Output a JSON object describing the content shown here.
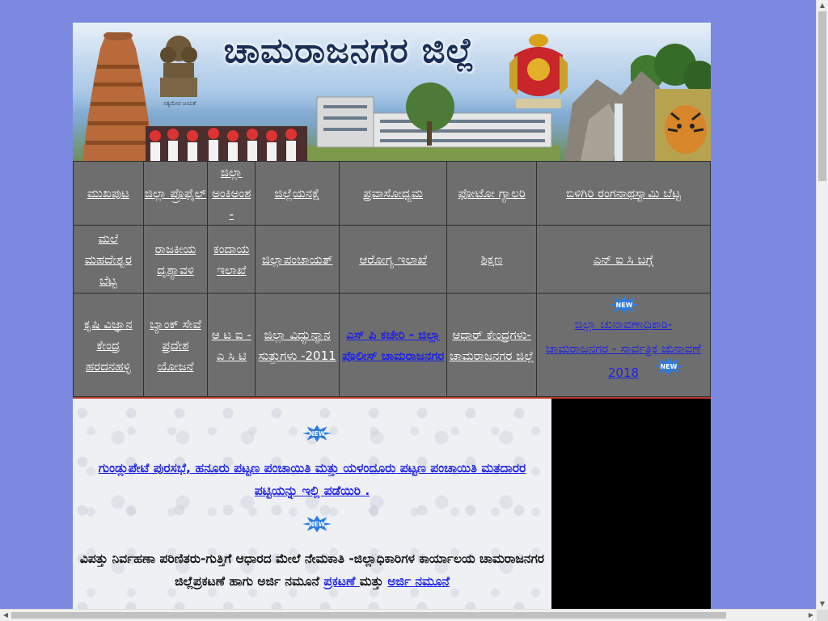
{
  "banner": {
    "title": "ಚಾಮರಾಜನಗರ ಜಿಲ್ಲೆ",
    "motto": "ಸತ್ಯಮೇವ ಜಯತೆ"
  },
  "nav": {
    "row1": [
      {
        "label": "ಮುಖಪುಟ"
      },
      {
        "label": "ಜಿಲ್ಲಾ ಪ್ರೊಫೈಲ್"
      },
      {
        "label": "ಜಿಲ್ಲಾ ಅಂಕಿಅಂಶ -"
      },
      {
        "label": "ಜಿಲ್ಲೆಯನಕ್ಷೆ"
      },
      {
        "label": "ಪ್ರವಾಸೋಧ್ಯಮ"
      },
      {
        "label": "ಫೋಟೋ ಗ್ಯಾಲರಿ"
      },
      {
        "label": "ಬಿಳಿಗಿರಿ ರಂಗನಾಥಸ್ವಾಮಿ ಬೆಟ್ಟ"
      }
    ],
    "row2": [
      {
        "label": "ಮಲೆ ಮಹದೇಶ್ವರ ಬೆಟ್ಟ"
      },
      {
        "label": "ರಾಜಕೀಯ ದೃಶ್ಯಾವಳಿ"
      },
      {
        "label": "ಕಂದಾಯ ಇಲಾಖೆ"
      },
      {
        "label": "ಜಿಲ್ಲಾಪಂಚಾಯತ್"
      },
      {
        "label": "ಆರೋಗ್ಯ ಇಲಾಖೆ"
      },
      {
        "label": "ಶಿಕ್ಷಣ"
      },
      {
        "label": "ಎನ್ ಐ ಸಿ ಬಗ್ಗೆ"
      }
    ],
    "row3": [
      {
        "label": "ಕೃಷಿ ವಿಜ್ಞಾನ ಕೇಂದ್ರ ಹರದನಹಳ್ಳಿ"
      },
      {
        "label": "ಬ್ಯಾಂಕ್ ಸೇವೆ ಪ್ರದೇಶ ಯೋಜನೆ"
      },
      {
        "label": "ಆ ಟ ಐ - ಎ ಸಿ ಟಿ"
      },
      {
        "label": "ಜಿಲ್ಲಾ ವಿಧ್ಯುನ್ಮಾನ ಸುತ್ತುಗಳು -2011"
      },
      {
        "label": "ಎಸ್ ಪಿ ಕಚೇರಿ - ಜಿಲ್ಲಾ ಪೊಲೀಸ್ ಚಾಮರಾಜನಗರ"
      },
      {
        "label": "ಆಧಾರ್ ಕೇಂದ್ರಗಳು- ಚಾಮರಾಜನಗರ ಜಿಲ್ಲೆ"
      },
      {
        "label": "ಜಿಲ್ಲಾ ಚುನಾವಣಾಧಿಕಾರಿ-ಚಾಮರಾಜನಗರ - ಸಾರ್ವತ್ರಿಕ ಚುನಾವಣೆ 2018"
      }
    ]
  },
  "badges": {
    "new_label": "NEW"
  },
  "content": {
    "notice1": "ಗುಂಡ್ಲುಪೇಟೆ ಪುರಸಭೆ, ಹನೂರು ಪಟ್ಟಣ ಪಂಚಾಯಿತಿ ಮತ್ತು ಯಳಂದೂರು ಪಟ್ಟಣ ಪಂಚಾಯಿತಿ ಮತದಾರರ ಪಟ್ಟಿಯನ್ನು ಇಲ್ಲಿ ಪಡೆಯಿರಿ .",
    "notice2_text": "ವಿಪತ್ತು ನಿರ್ವಹಣಾ ಪರಿಣಿತರು-ಗುತ್ತಿಗೆ ಆಧಾರದ ಮೇಲೆ ನೇಮಕಾತಿ -ಜಿಲ್ಲಾಧಿಕಾರಿಗಳ ಕಾರ್ಯಾಲಯ ಚಾಮರಾಜನಗರ ಜಿಲ್ಲೆಪ್ರಕಟಣೆ ಹಾಗು ಅರ್ಜಿ ನಮೂನೆ ",
    "notice2_link1": "ಪ್ರಕಟಣೆ ",
    "notice2_mid": "ಮತ್ತು ",
    "notice2_link2": "ಅರ್ಜಿ ನಮೂನೆ"
  },
  "colors": {
    "page_bg": "#7b89e0",
    "nav_bg": "#6e6e6e",
    "link_blue": "#1e22e6",
    "sidebar": "#000000",
    "divider_red": "#c0392b"
  }
}
